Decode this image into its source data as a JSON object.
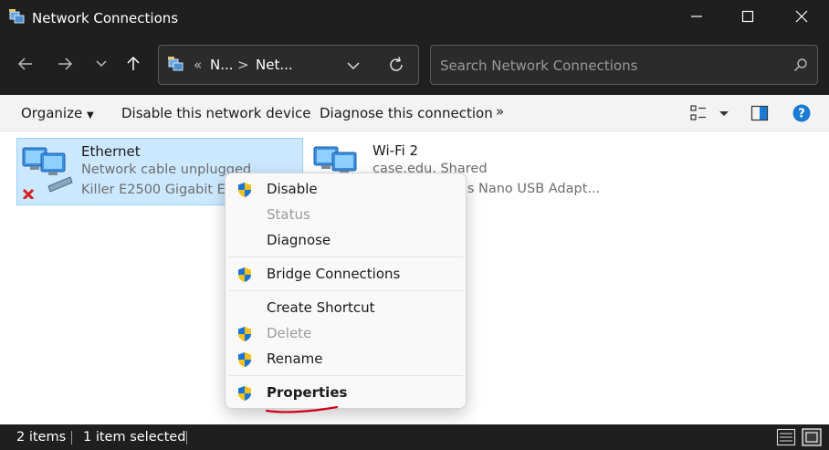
{
  "window": {
    "title": "Network Connections",
    "minimize_icon": "minimize-icon",
    "maximize_icon": "maximize-icon",
    "close_icon": "close-icon"
  },
  "address_bar": {
    "crumbs": [
      "N...",
      "Net..."
    ],
    "overflow": "«",
    "separator": ">"
  },
  "search": {
    "placeholder": "Search Network Connections"
  },
  "command_bar": {
    "organize": "Organize",
    "disable": "Disable this network device",
    "diagnose": "Diagnose this connection",
    "more": "»"
  },
  "connections": [
    {
      "name": "Ethernet",
      "status": "Network cable unplugged",
      "device": "Killer E2500 Gigabit Eth..."
    },
    {
      "name": "Wi-Fi 2",
      "status": "case.edu, Shared",
      "device": "...s Nano USB Adapt..."
    }
  ],
  "context_menu": {
    "items": [
      {
        "label": "Disable",
        "shield": true,
        "disabled": false
      },
      {
        "label": "Status",
        "shield": false,
        "disabled": true
      },
      {
        "label": "Diagnose",
        "shield": false,
        "disabled": false
      },
      {
        "label": "Bridge Connections",
        "shield": true,
        "disabled": false
      },
      {
        "label": "Create Shortcut",
        "shield": false,
        "disabled": false
      },
      {
        "label": "Delete",
        "shield": true,
        "disabled": true
      },
      {
        "label": "Rename",
        "shield": true,
        "disabled": false
      },
      {
        "label": "Properties",
        "shield": true,
        "disabled": false,
        "bold": true
      }
    ]
  },
  "status_bar": {
    "items_count": "2 items",
    "selected": "1 item selected"
  },
  "colors": {
    "dark_chrome": "#1f1f1f",
    "selection": "#cce8ff",
    "accent": "#0078d4",
    "annotation_underline": "#d0021b"
  }
}
